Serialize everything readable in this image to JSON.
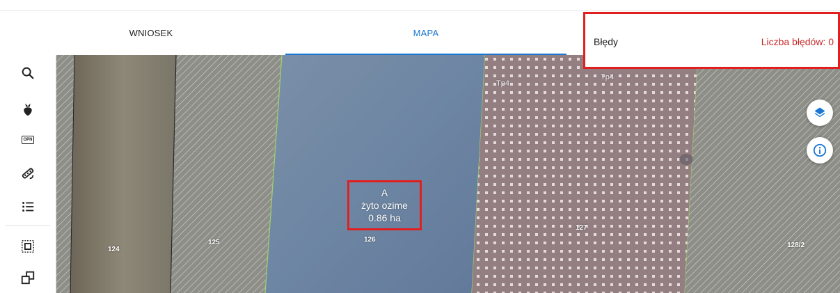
{
  "tabs": [
    {
      "label": "WNIOSEK",
      "active": false
    },
    {
      "label": "MAPA",
      "active": true
    }
  ],
  "errors_panel": {
    "title": "Błędy",
    "count_label": "Liczba błędów: 0"
  },
  "toolbar": {
    "tools": [
      "search-icon",
      "plant-icon",
      "opn-icon",
      "measure-icon",
      "list-icon",
      "select-area-icon",
      "clone-icon"
    ],
    "opn_text": "OPN"
  },
  "map": {
    "parcels": [
      {
        "id": "124",
        "label": "124"
      },
      {
        "id": "125",
        "label": "125"
      },
      {
        "id": "126",
        "label": "126"
      },
      {
        "id": "127",
        "label": "127"
      },
      {
        "id": "128/2",
        "label": "128/2"
      }
    ],
    "area_labels": [
      "Tp4",
      "Tp4"
    ],
    "selected_crop": {
      "code": "A",
      "crop": "żyto ozime",
      "area": "0.86 ha"
    },
    "controls": [
      "layers-icon",
      "info-icon"
    ]
  },
  "colors": {
    "accent": "#1976d2",
    "error": "#c62828",
    "highlight_border": "#e02020",
    "selected_parcel": "#6b84a1",
    "dotted_area": "#937f82",
    "parcel_border": "#9ed36a"
  }
}
